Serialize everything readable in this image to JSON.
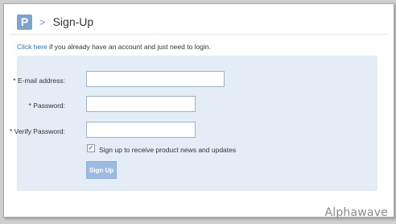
{
  "header": {
    "logo_letter": "P",
    "separator": ">",
    "title": "Sign-Up"
  },
  "login_prompt": {
    "link_text": "Click here",
    "text": " if you already have an account and just need to login."
  },
  "form": {
    "email_label": "* E-mail address:",
    "password_label": "* Password:",
    "verify_label": "* Verify Password:",
    "email_value": "",
    "password_value": "",
    "verify_value": "",
    "checkbox_checked": true,
    "checkbox_mark": "✓",
    "checkbox_label": "Sign up to receive product news and updates",
    "submit_label": "Sign Up"
  },
  "watermark": "Alphawave",
  "colors": {
    "accent": "#7ea3cf",
    "panel_bg": "#e4ecf6",
    "button_bg": "#9dbbe0",
    "link": "#2f6fb5"
  }
}
